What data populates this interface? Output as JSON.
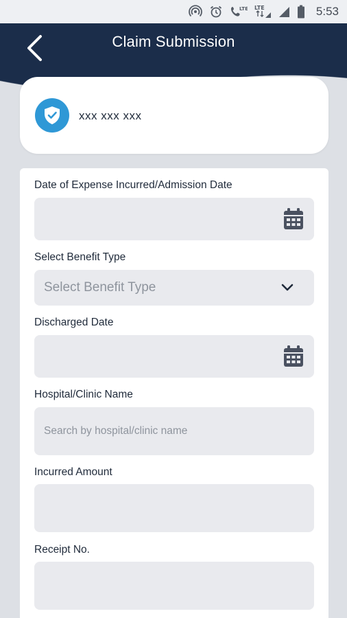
{
  "status_bar": {
    "time": "5:53",
    "icons": [
      "hotspot-icon",
      "alarm-icon",
      "volte-call-icon",
      "lte-signal-icon",
      "signal-icon",
      "signal-icon",
      "battery-icon"
    ],
    "lte_label": "LTE",
    "lte_label_2": "LTE"
  },
  "header": {
    "title": "Claim Submission",
    "background_color": "#1b2d4a"
  },
  "policy_card": {
    "policy_number": "xxx xxx xxx",
    "badge_color": "#2f98d6"
  },
  "form": {
    "admission_date": {
      "label": "Date of Expense Incurred/Admission Date",
      "value": ""
    },
    "benefit_type": {
      "label": "Select Benefit Type",
      "placeholder": "Select Benefit Type"
    },
    "discharged_date": {
      "label": "Discharged Date",
      "value": ""
    },
    "hospital": {
      "label": "Hospital/Clinic Name",
      "placeholder": "Search by hospital/clinic name"
    },
    "incurred_amount": {
      "label": "Incurred Amount",
      "value": ""
    },
    "receipt_no": {
      "label": "Receipt No.",
      "value": ""
    }
  }
}
